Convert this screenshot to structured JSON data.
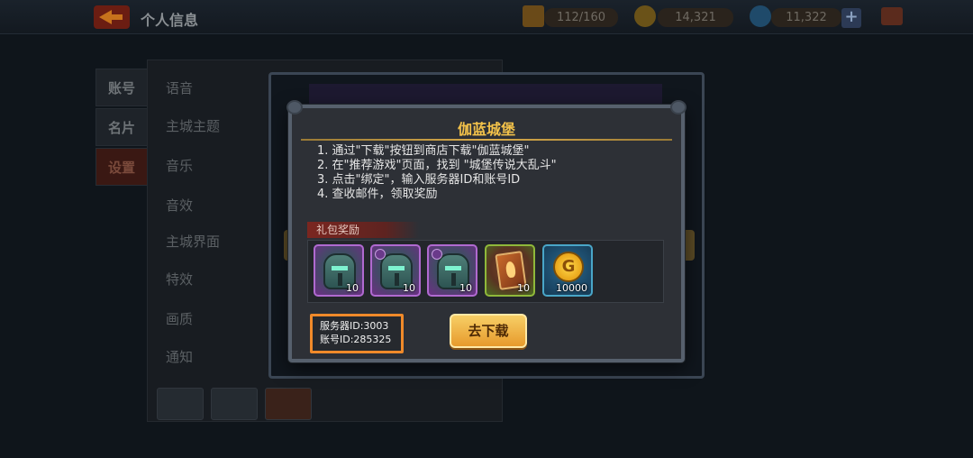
{
  "header": {
    "title": "个人信息",
    "stamina": "112/160",
    "coins": "14,321",
    "gems": "11,322"
  },
  "sidebar": {
    "tabs": [
      "账号",
      "名片",
      "设置"
    ],
    "active_index": 2
  },
  "settings": {
    "rows": [
      "语音",
      "主城主题",
      "音乐",
      "音效",
      "主城界面",
      "特效",
      "画质",
      "通知"
    ]
  },
  "dialog": {
    "title": "伽蓝城堡",
    "instructions": [
      "1. 通过\"下载\"按钮到商店下载\"伽蓝城堡\"",
      "2. 在\"推荐游戏\"页面，找到 \"城堡传说大乱斗\"",
      "3. 点击\"绑定\"，输入服务器ID和账号ID",
      "4. 查收邮件，领取奖励"
    ],
    "reward_label": "礼包奖励",
    "rewards": [
      {
        "icon": "helmet-icon",
        "qty": "10"
      },
      {
        "icon": "helmet-icon",
        "qty": "10"
      },
      {
        "icon": "helmet-icon",
        "qty": "10"
      },
      {
        "icon": "card-icon",
        "qty": "10"
      },
      {
        "icon": "gold-coin-icon",
        "qty": "10000"
      }
    ],
    "server_id": "服务器ID:3003",
    "account_id": "账号ID:285325",
    "download_button": "去下载"
  },
  "colors": {
    "title_gold": "#f3c24a",
    "highlight_orange": "#f08a2a",
    "button_gold": "#e79a2c",
    "reward_purple": "#b06ad0"
  }
}
